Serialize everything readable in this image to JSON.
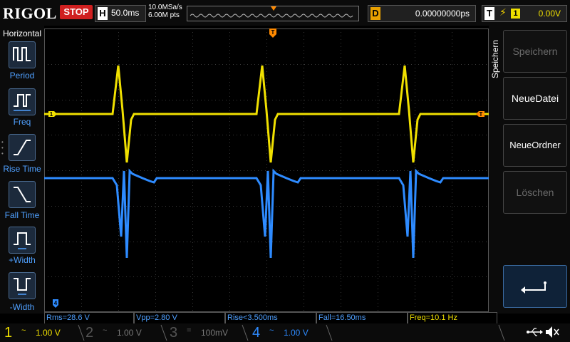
{
  "brand": "RIGOL",
  "run_status": "STOP",
  "horizontal": {
    "key": "H",
    "timebase": "50.0ms",
    "sample_rate": "10.0MSa/s",
    "memory": "6.00M pts"
  },
  "delay": {
    "key": "D",
    "value": "0.00000000ps"
  },
  "trigger": {
    "key": "T",
    "edge_icon": "rising-edge-icon",
    "source": "1",
    "level": "0.00V"
  },
  "left_menu": {
    "title": "Horizontal",
    "items": [
      {
        "label": "Period",
        "icon": "period-icon"
      },
      {
        "label": "Freq",
        "icon": "freq-icon"
      },
      {
        "label": "Rise Time",
        "icon": "rise-time-icon"
      },
      {
        "label": "Fall Time",
        "icon": "fall-time-icon"
      },
      {
        "label": "+Width",
        "icon": "pos-width-icon"
      },
      {
        "label": "-Width",
        "icon": "neg-width-icon"
      }
    ]
  },
  "right_menu": {
    "title": "Speichern",
    "buttons": [
      {
        "label": "Speichern",
        "enabled": false
      },
      {
        "label": "NeueDatei",
        "enabled": true
      },
      {
        "label": "NeueOrdner",
        "enabled": true
      },
      {
        "label": "Löschen",
        "enabled": false
      }
    ],
    "back_icon": "return-arrow-icon"
  },
  "markers": {
    "ch1": "1",
    "ch4": "4",
    "trigger_level": "T"
  },
  "measurements": [
    {
      "text": "Rms=28.6 V",
      "color": "#4fa0ff"
    },
    {
      "text": "Vpp=2.80 V",
      "color": "#4fa0ff"
    },
    {
      "text": "Rise<3.500ms",
      "color": "#4fa0ff"
    },
    {
      "text": "Fall=16.50ms",
      "color": "#4fa0ff"
    },
    {
      "text": "Freq=10.1 Hz",
      "color": "#f0e000"
    }
  ],
  "channels": [
    {
      "num": "1",
      "coupling": "~",
      "scale": "1.00 V",
      "color": "#f0e000",
      "active": true
    },
    {
      "num": "2",
      "coupling": "~",
      "scale": "1.00 V",
      "color": "#555555",
      "active": false
    },
    {
      "num": "3",
      "coupling": "=",
      "scale": "100mV",
      "color": "#555555",
      "active": false
    },
    {
      "num": "4",
      "coupling": "~",
      "scale": "1.00 V",
      "color": "#2e8bff",
      "active": true
    }
  ],
  "status_icons": [
    "usb-icon",
    "speaker-muted-icon"
  ],
  "colors": {
    "ch1": "#f0e000",
    "ch4": "#2e8bff",
    "trigger": "#ff8a00",
    "stop": "#d02020"
  }
}
